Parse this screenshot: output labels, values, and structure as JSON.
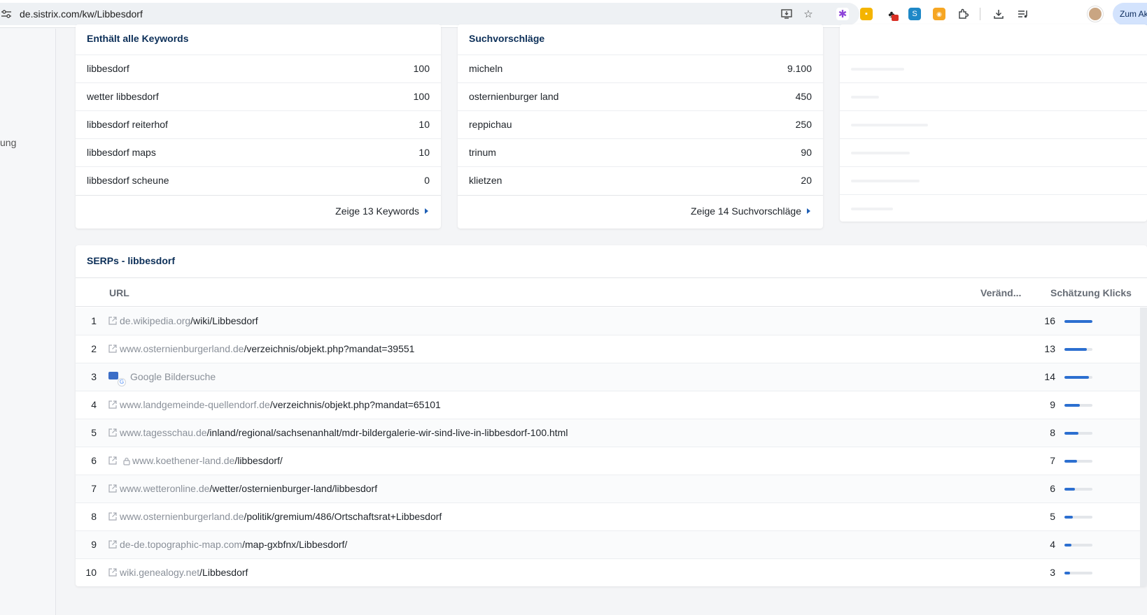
{
  "browser": {
    "url": "de.sistrix.com/kw/Libbesdorf",
    "profile_button": "Zum Ak"
  },
  "sidebar": {
    "partial_label": "ung"
  },
  "keywords_card": {
    "title": "Enthält alle Keywords",
    "rows": [
      {
        "keyword": "libbesdorf",
        "value": "100"
      },
      {
        "keyword": "wetter libbesdorf",
        "value": "100"
      },
      {
        "keyword": "libbesdorf reiterhof",
        "value": "10"
      },
      {
        "keyword": "libbesdorf maps",
        "value": "10"
      },
      {
        "keyword": "libbesdorf scheune",
        "value": "0"
      }
    ],
    "footer_link": "Zeige 13 Keywords"
  },
  "suggestions_card": {
    "title": "Suchvorschläge",
    "rows": [
      {
        "keyword": "micheln",
        "value": "9.100"
      },
      {
        "keyword": "osternienburger land",
        "value": "450"
      },
      {
        "keyword": "reppichau",
        "value": "250"
      },
      {
        "keyword": "trinum",
        "value": "90"
      },
      {
        "keyword": "klietzen",
        "value": "20"
      }
    ],
    "footer_link": "Zeige 14 Suchvorschläge"
  },
  "serps": {
    "title": "SERPs - libbesdorf",
    "columns": {
      "url": "URL",
      "change": "Veränd...",
      "clicks": "Schätzung Klicks"
    },
    "rows": [
      {
        "rank": "1",
        "host": "de.wikipedia.org",
        "path": "/wiki/Libbesdorf",
        "clicks": "16",
        "share": 1.0
      },
      {
        "rank": "2",
        "host": "www.osternienburgerland.de",
        "path": "/verzeichnis/objekt.php?mandat=39551",
        "clicks": "13",
        "share": 0.81
      },
      {
        "rank": "3",
        "host": "Google Bildersuche",
        "path": "",
        "clicks": "14",
        "share": 0.88
      },
      {
        "rank": "4",
        "host": "www.landgemeinde-quellendorf.de",
        "path": "/verzeichnis/objekt.php?mandat=65101",
        "clicks": "9",
        "share": 0.56
      },
      {
        "rank": "5",
        "host": "www.tagesschau.de",
        "path": "/inland/regional/sachsenanhalt/mdr-bildergalerie-wir-sind-live-in-libbesdorf-100.html",
        "clicks": "8",
        "share": 0.5
      },
      {
        "rank": "6",
        "host": "www.koethener-land.de",
        "path": "/libbesdorf/",
        "clicks": "7",
        "share": 0.44
      },
      {
        "rank": "7",
        "host": "www.wetteronline.de",
        "path": "/wetter/osternienburger-land/libbesdorf",
        "clicks": "6",
        "share": 0.38
      },
      {
        "rank": "8",
        "host": "www.osternienburgerland.de",
        "path": "/politik/gremium/486/Ortschaftsrat+Libbesdorf",
        "clicks": "5",
        "share": 0.31
      },
      {
        "rank": "9",
        "host": "de-de.topographic-map.com",
        "path": "/map-gxbfnx/Libbesdorf/",
        "clicks": "4",
        "share": 0.25
      },
      {
        "rank": "10",
        "host": "wiki.genealogy.net",
        "path": "/Libbesdorf",
        "clicks": "3",
        "share": 0.19
      }
    ]
  },
  "colors": {
    "title": "#0c2f58",
    "bar": "#2c6fd0",
    "host": "#8a9099"
  }
}
